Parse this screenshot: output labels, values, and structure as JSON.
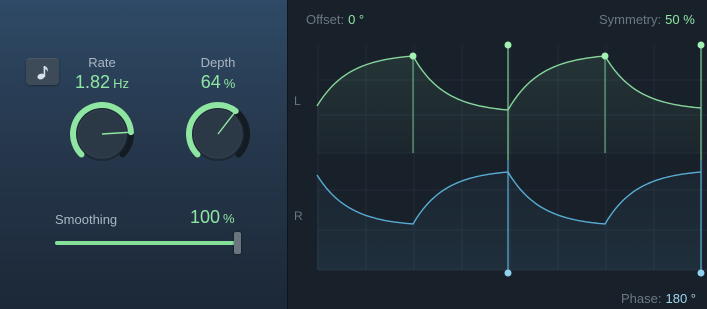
{
  "left": {
    "sync_icon": "note-icon",
    "rate": {
      "label": "Rate",
      "value": "1.82",
      "unit": "Hz",
      "fraction": 0.82
    },
    "depth": {
      "label": "Depth",
      "value": "64",
      "unit": "%",
      "fraction": 0.64
    },
    "smoothing": {
      "label": "Smoothing",
      "value": "100",
      "unit": "%",
      "fraction": 1.0
    }
  },
  "right": {
    "offset": {
      "label": "Offset:",
      "value": "0 °"
    },
    "symmetry": {
      "label": "Symmetry:",
      "value": "50 %"
    },
    "phase": {
      "label": "Phase:",
      "value": "180 °"
    },
    "channel_left": "L",
    "channel_right": "R"
  },
  "colors": {
    "green": "#8fe6a3",
    "blue": "#5fb4d8",
    "label": "#a9b6c3"
  }
}
